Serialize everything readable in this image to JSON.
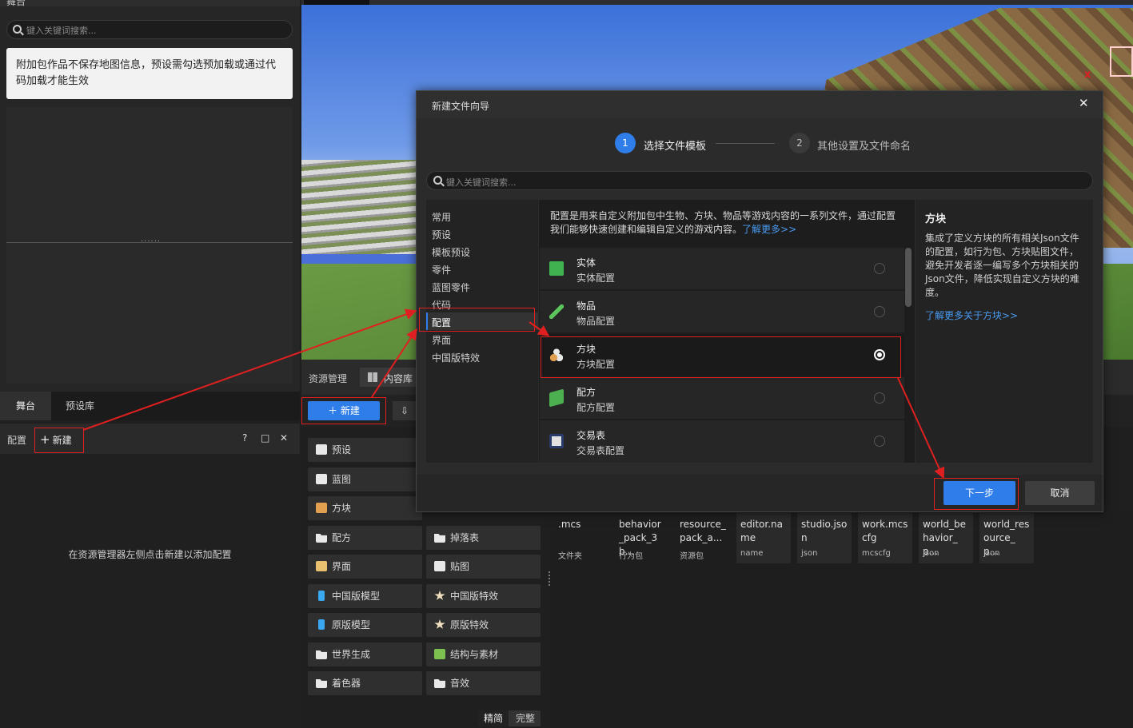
{
  "stage_panel": {
    "title": "舞台",
    "search_placeholder": "键入关键词搜索...",
    "notice": "附加包作品不保存地图信息，预设需勾选预加载或通过代码加载才能生效",
    "tabs": [
      "舞台",
      "预设库"
    ]
  },
  "config_panel": {
    "title": "配置",
    "new_label": "新建",
    "help": "?",
    "maximize": "□",
    "close": "✕",
    "empty_hint": "在资源管理器左侧点击新建以添加配置"
  },
  "resource_manager": {
    "title": "资源管理",
    "content_tab": "内容库",
    "new_button": "新建",
    "categories_left": [
      "预设",
      "蓝图",
      "方块",
      "配方",
      "界面",
      "中国版模型",
      "原版模型",
      "世界生成",
      "着色器"
    ],
    "categories_right": [
      "掉落表",
      "贴图",
      "中国版特效",
      "原版特效",
      "结构与素材",
      "音效"
    ],
    "mode_simple": "精简",
    "mode_full": "完整",
    "files": [
      {
        "name": ".mcs",
        "type": "文件夹"
      },
      {
        "name": "behavior_pack_3b...",
        "type": "行为包"
      },
      {
        "name": "resource_pack_a...",
        "type": "资源包"
      },
      {
        "name": "editor.name",
        "type": "name"
      },
      {
        "name": "studio.json",
        "type": "json"
      },
      {
        "name": "work.mcscfg",
        "type": "mcscfg"
      },
      {
        "name": "world_behavior_p...",
        "type": "json"
      },
      {
        "name": "world_resource_p...",
        "type": "json"
      }
    ]
  },
  "dialog": {
    "title": "新建文件向导",
    "close": "✕",
    "steps": [
      {
        "num": "1",
        "label": "选择文件模板"
      },
      {
        "num": "2",
        "label": "其他设置及文件命名"
      }
    ],
    "search_placeholder": "键入关键词搜索...",
    "categories": [
      "常用",
      "预设",
      "模板预设",
      "零件",
      "蓝图零件",
      "代码",
      "配置",
      "界面",
      "中国版特效"
    ],
    "selected_category": "配置",
    "description": "配置是用来自定义附加包中生物、方块、物品等游戏内容的一系列文件，通过配置我们能够快速创建和编辑自定义的游戏内容。",
    "description_link": "了解更多>>",
    "options": [
      {
        "name": "实体",
        "desc": "实体配置",
        "icon": "creeper-icon",
        "color": "#3fb34f"
      },
      {
        "name": "物品",
        "desc": "物品配置",
        "icon": "pickaxe-icon",
        "color": "#5cc45c"
      },
      {
        "name": "方块",
        "desc": "方块配置",
        "icon": "blocks-icon",
        "color": "#e0a050"
      },
      {
        "name": "配方",
        "desc": "配方配置",
        "icon": "book-icon",
        "color": "#4caf50"
      },
      {
        "name": "交易表",
        "desc": "交易表配置",
        "icon": "trade-icon",
        "color": "#e0e0e0"
      }
    ],
    "selected_option": "方块",
    "info": {
      "title": "方块",
      "text": "集成了定义方块的所有相关Json文件的配置，如行为包、方块贴图文件，避免开发者逐一编写多个方块相关的Json文件，降低实现自定义方块的难度。",
      "link": "了解更多关于方块>>"
    },
    "next_button": "下一步",
    "cancel_button": "取消"
  },
  "colors": {
    "accent": "#2e7de8",
    "annotation": "#e02020"
  }
}
